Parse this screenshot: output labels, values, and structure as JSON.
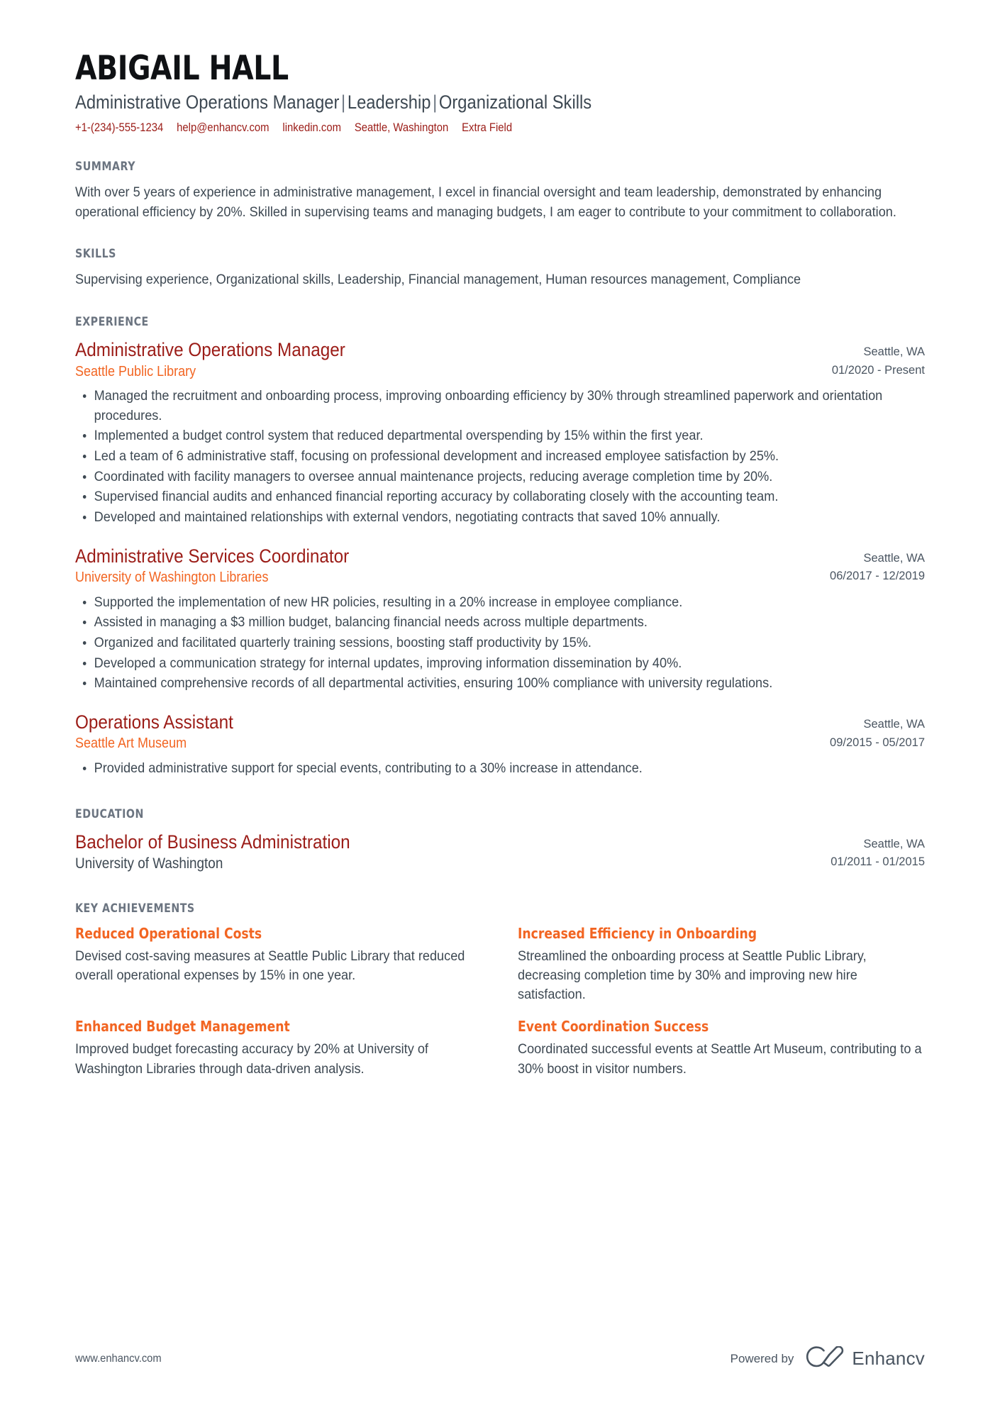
{
  "colors": {
    "name": "#0f1114",
    "accent_red": "#9b1c17",
    "accent_orange": "#f26522",
    "body": "#3d4852",
    "section_label": "#6b7480",
    "background": "#ffffff"
  },
  "header": {
    "full_name": "ABIGAIL HALL",
    "headline_parts": [
      "Administrative Operations Manager",
      "Leadership",
      "Organizational Skills"
    ],
    "headline": "Administrative Operations Manager | Leadership | Organizational Skills",
    "contacts": [
      {
        "name": "phone",
        "text": "+1-(234)-555-1234"
      },
      {
        "name": "email",
        "text": "help@enhancv.com"
      },
      {
        "name": "linkedin",
        "text": "linkedin.com"
      },
      {
        "name": "location",
        "text": "Seattle, Washington"
      },
      {
        "name": "extra-field",
        "text": "Extra Field"
      }
    ]
  },
  "summary": {
    "title": "SUMMARY",
    "text": "With over 5 years of experience in administrative management, I excel in financial oversight and team leadership, demonstrated by enhancing operational efficiency by 20%. Skilled in supervising teams and managing budgets, I am eager to contribute to your commitment to collaboration."
  },
  "skills": {
    "title": "SKILLS",
    "text": "Supervising experience, Organizational skills, Leadership, Financial management, Human resources management, Compliance"
  },
  "experience": {
    "title": "EXPERIENCE",
    "entries": [
      {
        "position": "Administrative Operations Manager",
        "company": "Seattle Public Library",
        "location": "Seattle, WA",
        "dates": "01/2020 - Present",
        "bullets": [
          "Managed the recruitment and onboarding process, improving onboarding efficiency by 30% through streamlined paperwork and orientation procedures.",
          "Implemented a budget control system that reduced departmental overspending by 15% within the first year.",
          "Led a team of 6 administrative staff, focusing on professional development and increased employee satisfaction by 25%.",
          "Coordinated with facility managers to oversee annual maintenance projects, reducing average completion time by 20%.",
          "Supervised financial audits and enhanced financial reporting accuracy by collaborating closely with the accounting team.",
          "Developed and maintained relationships with external vendors, negotiating contracts that saved 10% annually."
        ]
      },
      {
        "position": "Administrative Services Coordinator",
        "company": "University of Washington Libraries",
        "location": "Seattle, WA",
        "dates": "06/2017 - 12/2019",
        "bullets": [
          "Supported the implementation of new HR policies, resulting in a 20% increase in employee compliance.",
          "Assisted in managing a $3 million budget, balancing financial needs across multiple departments.",
          "Organized and facilitated quarterly training sessions, boosting staff productivity by 15%.",
          "Developed a communication strategy for internal updates, improving information dissemination by 40%.",
          "Maintained comprehensive records of all departmental activities, ensuring 100% compliance with university regulations."
        ]
      },
      {
        "position": "Operations Assistant",
        "company": "Seattle Art Museum",
        "location": "Seattle, WA",
        "dates": "09/2015 - 05/2017",
        "bullets": [
          "Provided administrative support for special events, contributing to a 30% increase in attendance."
        ]
      }
    ]
  },
  "education": {
    "title": "EDUCATION",
    "entries": [
      {
        "degree": "Bachelor of Business Administration",
        "school": "University of Washington",
        "location": "Seattle, WA",
        "dates": "01/2011 - 01/2015"
      }
    ]
  },
  "achievements": {
    "title": "KEY ACHIEVEMENTS",
    "items": [
      {
        "title": "Reduced Operational Costs",
        "text": "Devised cost-saving measures at Seattle Public Library that reduced overall operational expenses by 15% in one year."
      },
      {
        "title": "Increased Efficiency in Onboarding",
        "text": "Streamlined the onboarding process at Seattle Public Library, decreasing completion time by 30% and improving new hire satisfaction."
      },
      {
        "title": "Enhanced Budget Management",
        "text": "Improved budget forecasting accuracy by 20% at University of Washington Libraries through data-driven analysis."
      },
      {
        "title": "Event Coordination Success",
        "text": "Coordinated successful events at Seattle Art Museum, contributing to a 30% boost in visitor numbers."
      }
    ]
  },
  "footer": {
    "url": "www.enhancv.com",
    "powered_by": "Powered by",
    "brand": "Enhancv",
    "logo_icon": "enhancv-infinity-check-icon"
  }
}
